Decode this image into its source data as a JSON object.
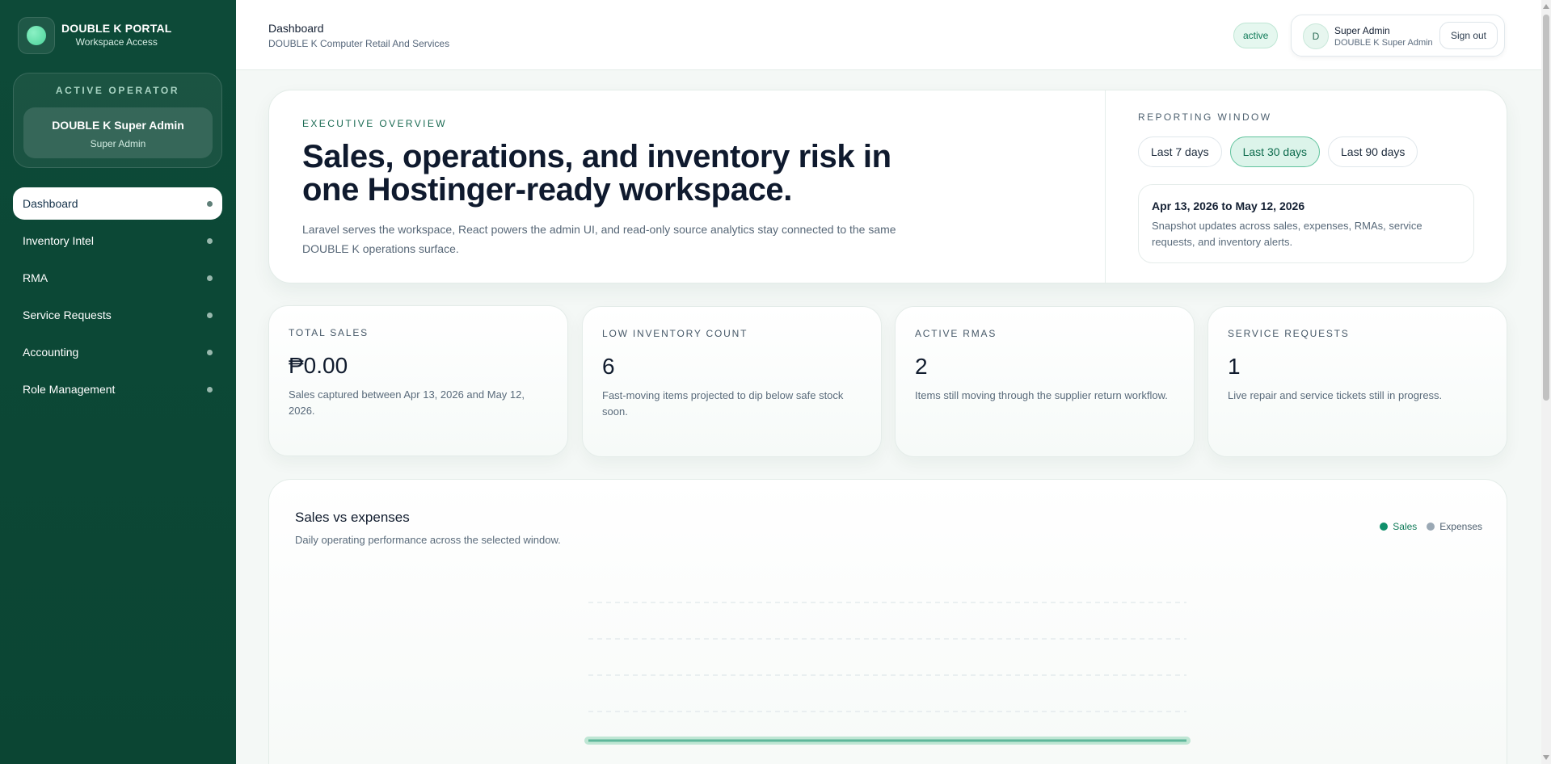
{
  "brand": {
    "title": "DOUBLE K PORTAL",
    "subtitle": "Workspace Access"
  },
  "operator": {
    "label": "ACTIVE OPERATOR",
    "name": "DOUBLE K Super Admin",
    "role": "Super Admin"
  },
  "nav": [
    {
      "label": "Dashboard",
      "active": true
    },
    {
      "label": "Inventory Intel",
      "active": false
    },
    {
      "label": "RMA",
      "active": false
    },
    {
      "label": "Service Requests",
      "active": false
    },
    {
      "label": "Accounting",
      "active": false
    },
    {
      "label": "Role Management",
      "active": false
    }
  ],
  "topbar": {
    "title": "Dashboard",
    "subtitle": "DOUBLE K Computer Retail And Services",
    "status": "active",
    "user": {
      "initial": "D",
      "name": "Super Admin",
      "org": "DOUBLE K Super Admin",
      "signout_label": "Sign out"
    }
  },
  "hero": {
    "eyebrow": "EXECUTIVE OVERVIEW",
    "title": "Sales, operations, and inventory risk in one Hostinger-ready workspace.",
    "description": "Laravel serves the workspace, React powers the admin UI, and read-only source analytics stay connected to the same DOUBLE K operations surface.",
    "reporting": {
      "label": "REPORTING WINDOW",
      "ranges": [
        "Last 7 days",
        "Last 30 days",
        "Last 90 days"
      ],
      "selected": "Last 30 days",
      "dates": "Apr 13, 2026 to May 12, 2026",
      "note": "Snapshot updates across sales, expenses, RMAs, service requests, and inventory alerts."
    }
  },
  "stats": [
    {
      "label": "TOTAL SALES",
      "value": "₱0.00",
      "note": "Sales captured between Apr 13, 2026 and May 12, 2026."
    },
    {
      "label": "LOW INVENTORY COUNT",
      "value": "6",
      "note": "Fast-moving items projected to dip below safe stock soon."
    },
    {
      "label": "ACTIVE RMAS",
      "value": "2",
      "note": "Items still moving through the supplier return workflow."
    },
    {
      "label": "SERVICE REQUESTS",
      "value": "1",
      "note": "Live repair and service tickets still in progress."
    }
  ],
  "chart": {
    "title": "Sales vs expenses",
    "subtitle": "Daily operating performance across the selected window.",
    "legend": [
      {
        "name": "Sales",
        "color": "#0f8f6a"
      },
      {
        "name": "Expenses",
        "color": "#9aa8b4"
      }
    ]
  },
  "chart_data": {
    "type": "area",
    "title": "Sales vs expenses",
    "grid": true,
    "legend_position": "top-right",
    "series": [
      {
        "name": "Sales",
        "color": "#0f8f6a",
        "values": [
          0
        ]
      },
      {
        "name": "Expenses",
        "color": "#9aa8b4",
        "values": [
          0
        ]
      }
    ]
  },
  "colors": {
    "sidebar": "#0d4a38",
    "accent": "#0f8f6a",
    "active_pill": "#dcf4ea"
  }
}
